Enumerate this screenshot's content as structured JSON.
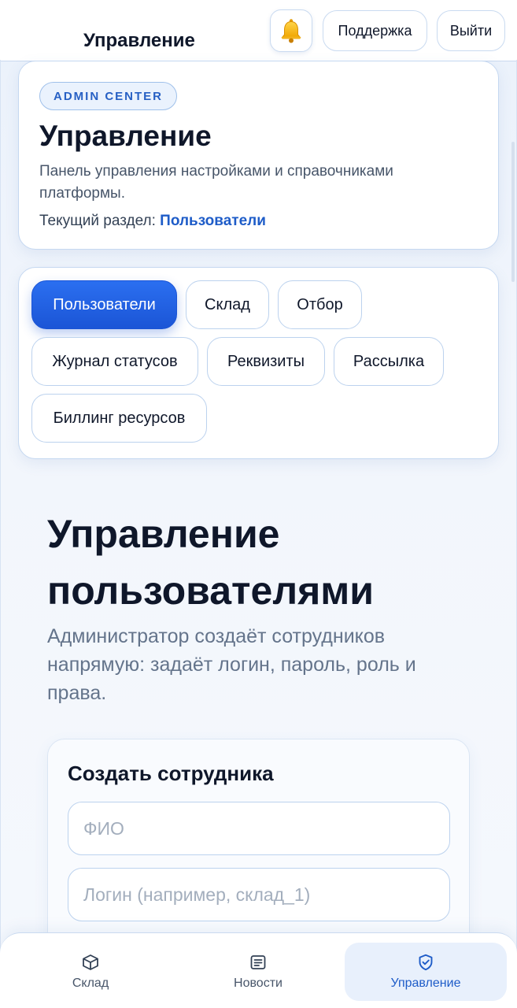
{
  "header": {
    "title": "Управление",
    "bell_icon": "bell-icon",
    "support_label": "Поддержка",
    "logout_label": "Выйти"
  },
  "hero": {
    "badge": "ADMIN CENTER",
    "title": "Управление",
    "description": "Панель управления настройками и справочниками платформы.",
    "current_label": "Текущий раздел:",
    "current_value": "Пользователи"
  },
  "tabs": [
    {
      "label": "Пользователи",
      "active": true
    },
    {
      "label": "Склад",
      "active": false
    },
    {
      "label": "Отбор",
      "active": false
    },
    {
      "label": "Журнал статусов",
      "active": false
    },
    {
      "label": "Реквизиты",
      "active": false
    },
    {
      "label": "Рассылка",
      "active": false
    },
    {
      "label": "Биллинг ресурсов",
      "active": false
    }
  ],
  "section": {
    "title": "Управление пользователями",
    "description": "Администратор создаёт сотрудников напрямую: задаёт логин, пароль, роль и права."
  },
  "form": {
    "title": "Создать сотрудника",
    "fio_placeholder": "ФИО",
    "fio_value": "",
    "login_placeholder": "Логин (например, склад_1)",
    "login_value": ""
  },
  "bottom_nav": [
    {
      "label": "Склад",
      "icon": "box-icon",
      "active": false
    },
    {
      "label": "Новости",
      "icon": "news-icon",
      "active": false
    },
    {
      "label": "Управление",
      "icon": "shield-check-icon",
      "active": true
    }
  ],
  "colors": {
    "accent": "#1e5cc8",
    "active_tab": "#2b6ff0",
    "border": "#c5d8f1"
  }
}
